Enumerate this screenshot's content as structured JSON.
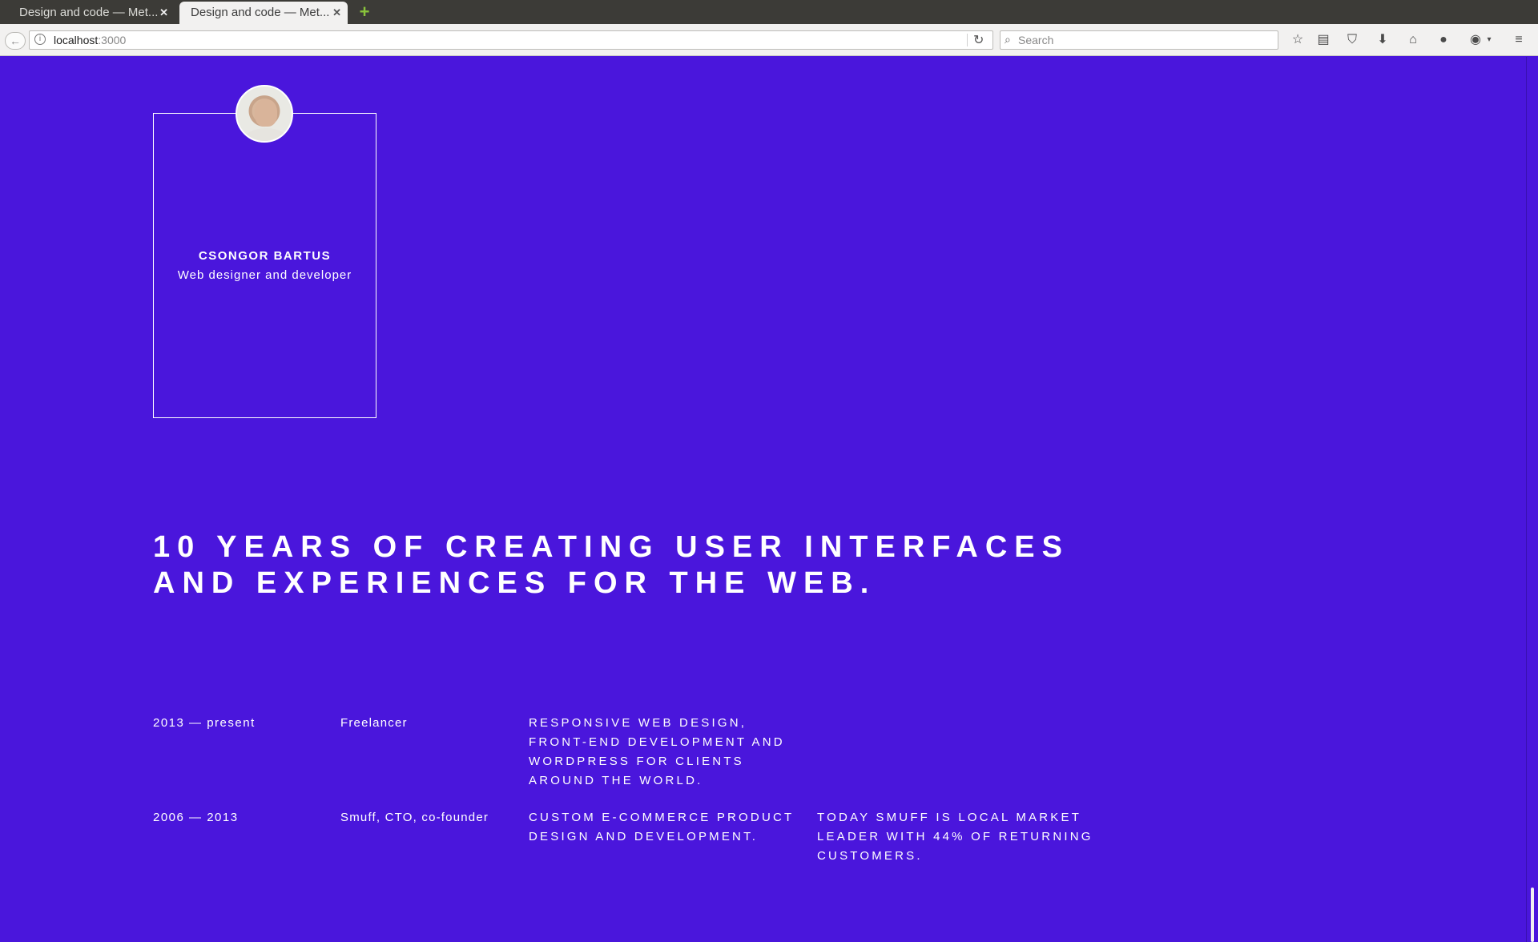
{
  "browser": {
    "tabs": [
      {
        "title": "Design and code — Met...",
        "active": false
      },
      {
        "title": "Design and code — Met...",
        "active": true
      }
    ],
    "url": {
      "host": "localhost",
      "port": ":3000"
    },
    "search_placeholder": "Search",
    "icons": {
      "back": "back-arrow-icon",
      "info": "info-icon",
      "reload": "reload-icon",
      "search": "search-icon",
      "bookmark": "star-icon",
      "reading_list": "clipboard-icon",
      "pocket": "pocket-icon",
      "downloads": "download-arrow-icon",
      "home": "home-icon",
      "chat": "chat-bubble-icon",
      "adblock": "adblock-icon",
      "menu": "hamburger-menu-icon"
    }
  },
  "profile": {
    "name": "CSONGOR BARTUS",
    "role": "Web designer and developer"
  },
  "headline": "10 YEARS OF CREATING USER INTERFACES AND EXPERIENCES FOR THE WEB.",
  "experience": [
    {
      "period": "2013 — present",
      "role": "Freelancer",
      "description": "RESPONSIVE WEB DESIGN, FRONT-END DEVELOPMENT AND WORDPRESS FOR CLIENTS AROUND THE WORLD.",
      "note": ""
    },
    {
      "period": "2006 — 2013",
      "role": "Smuff, CTO, co-founder",
      "description": "CUSTOM E-COMMERCE PRODUCT DESIGN AND DEVELOPMENT.",
      "note": "TODAY SMUFF IS LOCAL MARKET LEADER WITH 44% OF RETURNING CUSTOMERS."
    }
  ],
  "colors": {
    "page_background": "#4a16dc",
    "text": "#ffffff",
    "tab_strip": "#3c3b37",
    "toolbar": "#f2f1f0"
  }
}
